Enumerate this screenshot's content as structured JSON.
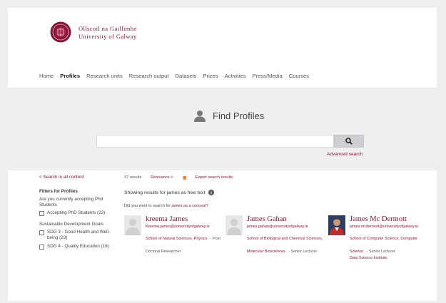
{
  "header": {
    "logo_line1": "Ollscoil na Gaillimhe",
    "logo_line2": "University of Galway",
    "top_link": "",
    "brand_color": "#8a1538"
  },
  "nav": {
    "items": [
      {
        "label": "Home",
        "active": false
      },
      {
        "label": "Profiles",
        "active": true
      },
      {
        "label": "Research units",
        "active": false
      },
      {
        "label": "Research output",
        "active": false
      },
      {
        "label": "Datasets",
        "active": false
      },
      {
        "label": "Prizes",
        "active": false
      },
      {
        "label": "Activities",
        "active": false
      },
      {
        "label": "Press/Media",
        "active": false
      },
      {
        "label": "Courses",
        "active": false
      }
    ]
  },
  "search": {
    "title": "Find Profiles",
    "title_icon": "person-icon",
    "input_value": "",
    "button_icon": "search-icon",
    "advanced_label": "Advanced search"
  },
  "sidebar": {
    "back_label": "< Search in all content",
    "filters_heading": "Filters for Profiles",
    "phd_question": "Are you currently accepting Phd Students",
    "phd_option": "Accepting PhD Students (23)",
    "sdg_heading": "Sustainable Development Goals",
    "sdg_options": [
      "SDG 3 - Good Health and Well-being (23)",
      "SDG 4 - Quality Education (16)"
    ]
  },
  "results": {
    "count": "37 results",
    "sort_label": "Relevance ˅",
    "rss_icon": "rss-icon",
    "export_label": "Export search results",
    "showing_text": "Showing results for james as free text",
    "info_icon": "info-icon",
    "did_you_mean_prefix": "Did you want to search for",
    "did_you_mean_link": "james as a concept?",
    "cards": [
      {
        "name": "kreema James",
        "email": "Kreema.james@universityofgalway.ie",
        "affiliation": "School of Natural Sciences, Physics",
        "role": "- Post Doctoral Researcher",
        "has_photo": false
      },
      {
        "name": "James Gahan",
        "email": "james.gahan@universityofgalway.ie",
        "affiliation": "School of Biological and Chemical Sciences, Molecular Biosciences",
        "role": "- Senior Lecturer",
        "has_photo": false
      },
      {
        "name": "James Mc Dermott",
        "email": "james.mcdermott@universityofgalway.ie",
        "affiliation": "School of Computer Science, Computer Science",
        "role": "- Senior Lecturer",
        "extra": "Data Science Institute",
        "has_photo": true
      }
    ]
  }
}
